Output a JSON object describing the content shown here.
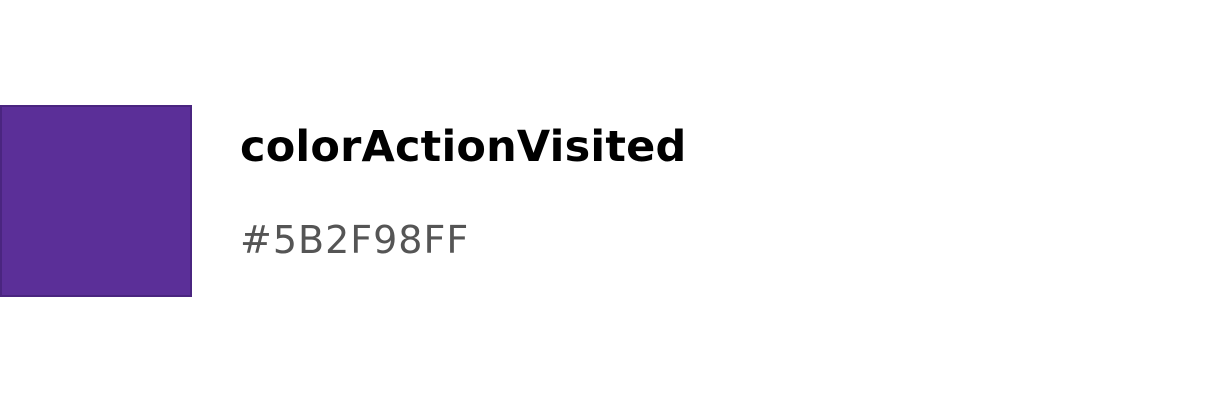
{
  "token": {
    "name": "colorActionVisited",
    "value": "#5B2F98FF",
    "swatch_color": "#5B2F98"
  }
}
